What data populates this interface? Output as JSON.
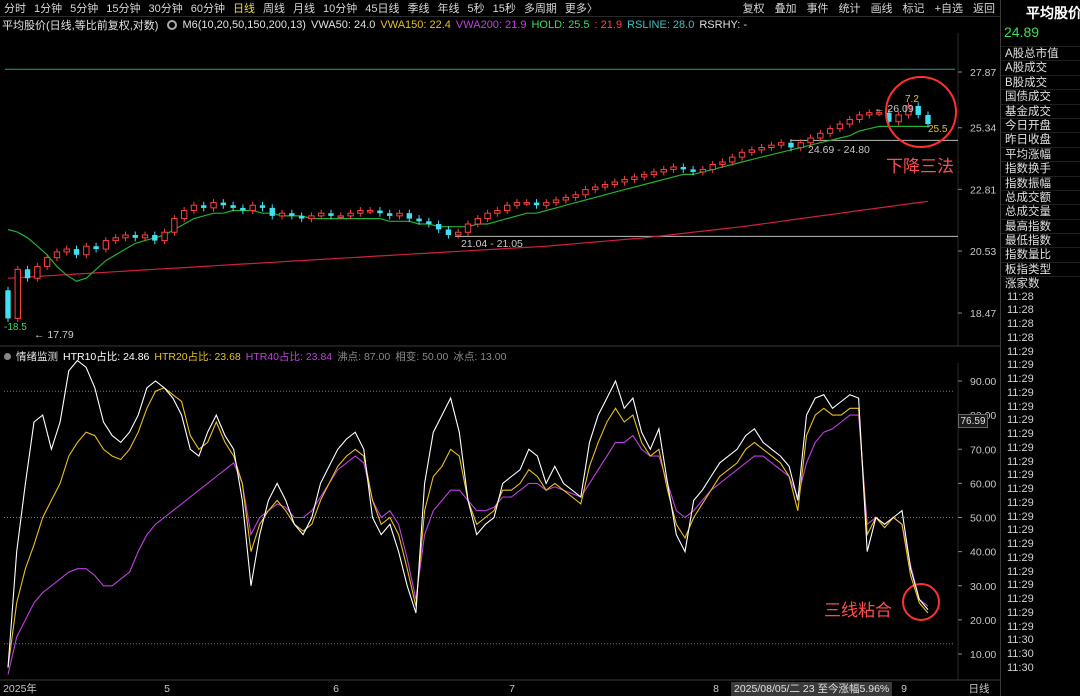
{
  "toolbar": {
    "periods": [
      {
        "label": "分时"
      },
      {
        "label": "1分钟"
      },
      {
        "label": "5分钟"
      },
      {
        "label": "15分钟"
      },
      {
        "label": "30分钟"
      },
      {
        "label": "60分钟"
      },
      {
        "label": "日线",
        "active": true
      },
      {
        "label": "周线"
      },
      {
        "label": "月线"
      },
      {
        "label": "10分钟"
      },
      {
        "label": "45日线"
      },
      {
        "label": "季线"
      },
      {
        "label": "年线"
      },
      {
        "label": "5秒"
      },
      {
        "label": "15秒"
      },
      {
        "label": "多周期"
      },
      {
        "label": "更多〉"
      }
    ],
    "right_buttons": [
      "复权",
      "叠加",
      "事件",
      "统计",
      "画线",
      "标记",
      "+自选",
      "返回"
    ]
  },
  "infobar": {
    "title": "平均股价(日线,等比前复权,对数)",
    "ma_label": "M6(10,20,50,150,200,13)",
    "vwa50": "VWA50: 24.0",
    "vwa150": "VWA150: 22.4",
    "vwa200": "VWA200: 21.9",
    "hold": "HOLD: 25.5",
    "hold_extra": ": 21.9",
    "rsline": "RSLINE: 28.0",
    "rsrhy": "RSRHY: -"
  },
  "indicator": {
    "name": "情绪监测",
    "htr10": "HTR10占比: 24.86",
    "htr20": "HTR20占比: 23.68",
    "htr40": "HTR40占比: 23.84",
    "boil": "沸点: 87.00",
    "phase": "相变: 50.00",
    "ice": "冰点: 13.00"
  },
  "price_axis": [
    "27.87",
    "25.34",
    "22.81",
    "20.53",
    "18.47"
  ],
  "ind_axis": [
    "90.00",
    "80.00",
    "70.00",
    "60.00",
    "50.00",
    "40.00",
    "30.00",
    "20.00",
    "10.00"
  ],
  "x_axis": [
    "2025年",
    "5",
    "6",
    "7",
    "8",
    "9",
    "日线"
  ],
  "price_labels": {
    "low": "17.79",
    "low_left": "-18.5",
    "range1": "21.04 - 21.05",
    "range2": "24.69 - 24.80",
    "high": "26.09",
    "top_val": "7.2",
    "last": "25.5"
  },
  "indicator_tag": "76.59",
  "date_tag": "2025/08/05/二 23 至今涨幅5.96%",
  "annotations": {
    "a1": "下降三法",
    "a2": "三线粘合"
  },
  "sidebar": {
    "title": "平均股价",
    "value": "24.89",
    "items": [
      "A股总市值",
      "A股成交",
      "B股成交",
      "国债成交",
      "基金成交",
      "今日开盘",
      "昨日收盘",
      "平均涨幅",
      "指数换手",
      "指数振幅",
      "总成交额",
      "总成交量",
      "最高指数",
      "最低指数",
      "指数量比",
      "板指类型",
      "涨家数"
    ],
    "times": [
      "11:28",
      "11:28",
      "11:28",
      "11:28",
      "11:29",
      "11:29",
      "11:29",
      "11:29",
      "11:29",
      "11:29",
      "11:29",
      "11:29",
      "11:29",
      "11:29",
      "11:29",
      "11:29",
      "11:29",
      "11:29",
      "11:29",
      "11:29",
      "11:29",
      "11:29",
      "11:29",
      "11:29",
      "11:29",
      "11:30",
      "11:30",
      "11:30"
    ]
  },
  "chart_data": {
    "type": "candlestick",
    "price_series": {
      "closes": [
        18.3,
        19.9,
        19.6,
        20.0,
        20.3,
        20.5,
        20.6,
        20.4,
        20.7,
        20.6,
        20.9,
        21.0,
        21.1,
        21.0,
        21.1,
        20.9,
        21.2,
        21.7,
        22.0,
        22.2,
        22.1,
        22.3,
        22.2,
        22.1,
        22.0,
        22.2,
        22.1,
        21.8,
        21.9,
        21.8,
        21.7,
        21.8,
        21.9,
        21.8,
        21.8,
        21.9,
        22.0,
        22.0,
        21.9,
        21.8,
        21.9,
        21.7,
        21.6,
        21.5,
        21.3,
        21.1,
        21.2,
        21.5,
        21.7,
        21.9,
        22.0,
        22.2,
        22.3,
        22.3,
        22.2,
        22.3,
        22.4,
        22.5,
        22.6,
        22.8,
        22.9,
        23.0,
        23.1,
        23.2,
        23.3,
        23.4,
        23.5,
        23.6,
        23.7,
        23.6,
        23.5,
        23.6,
        23.8,
        23.9,
        24.1,
        24.3,
        24.4,
        24.5,
        24.6,
        24.7,
        24.5,
        24.7,
        24.9,
        25.1,
        25.3,
        25.5,
        25.7,
        25.9,
        26.0,
        26.0,
        25.6,
        25.9,
        26.3,
        25.9,
        25.5
      ],
      "vwa_green": [
        21.3,
        21.2,
        21.0,
        20.7,
        20.4,
        20.0,
        19.7,
        19.5,
        19.6,
        19.9,
        20.2,
        20.4,
        20.6,
        20.8,
        20.9,
        21.0,
        21.1,
        21.3,
        21.5,
        21.7,
        21.8,
        21.9,
        21.9,
        22.0,
        22.0,
        22.0,
        21.9,
        21.9,
        21.8,
        21.8,
        21.8,
        21.7,
        21.7,
        21.7,
        21.7,
        21.7,
        21.7,
        21.7,
        21.7,
        21.6,
        21.6,
        21.6,
        21.5,
        21.5,
        21.4,
        21.4,
        21.4,
        21.4,
        21.5,
        21.5,
        21.6,
        21.7,
        21.8,
        21.9,
        21.9,
        22.0,
        22.1,
        22.2,
        22.3,
        22.4,
        22.5,
        22.6,
        22.7,
        22.8,
        22.9,
        23.0,
        23.1,
        23.2,
        23.3,
        23.4,
        23.4,
        23.5,
        23.6,
        23.7,
        23.8,
        23.9,
        24.0,
        24.1,
        24.2,
        24.3,
        24.4,
        24.5,
        24.6,
        24.7,
        24.8,
        24.9,
        25.0,
        25.2,
        25.3,
        25.4,
        25.4,
        25.4,
        25.4,
        25.4,
        25.4
      ],
      "vwa_red": [
        19.6,
        19.62,
        19.64,
        19.66,
        19.68,
        19.7,
        19.72,
        19.74,
        19.76,
        19.78,
        19.8,
        19.82,
        19.84,
        19.86,
        19.88,
        19.9,
        19.92,
        19.94,
        19.96,
        19.98,
        20.0,
        20.02,
        20.04,
        20.06,
        20.08,
        20.1,
        20.12,
        20.14,
        20.16,
        20.18,
        20.2,
        20.22,
        20.24,
        20.26,
        20.28,
        20.3,
        20.32,
        20.34,
        20.36,
        20.38,
        20.4,
        20.42,
        20.44,
        20.46,
        20.48,
        20.5,
        20.52,
        20.54,
        20.56,
        20.58,
        20.6,
        20.62,
        20.64,
        20.66,
        20.68,
        20.7,
        20.73,
        20.76,
        20.79,
        20.82,
        20.85,
        20.88,
        20.91,
        20.94,
        20.97,
        21.0,
        21.04,
        21.08,
        21.12,
        21.16,
        21.2,
        21.24,
        21.28,
        21.32,
        21.36,
        21.4,
        21.45,
        21.5,
        21.55,
        21.6,
        21.65,
        21.7,
        21.75,
        21.8,
        21.85,
        21.9,
        21.95,
        22.0,
        22.05,
        22.1,
        22.15,
        22.2,
        22.25,
        22.3,
        22.35
      ],
      "support_lines": [
        21.05,
        24.8
      ],
      "resistance_line": 28.0
    },
    "indicator_series": [
      {
        "name": "HTR10占比",
        "color": "#ffffff",
        "values": [
          6,
          40,
          60,
          78,
          80,
          70,
          78,
          93,
          96,
          94,
          88,
          78,
          74,
          72,
          75,
          80,
          88,
          90,
          88,
          85,
          80,
          70,
          68,
          75,
          80,
          74,
          70,
          55,
          30,
          45,
          55,
          60,
          55,
          48,
          45,
          50,
          60,
          65,
          70,
          73,
          75,
          70,
          50,
          45,
          48,
          40,
          30,
          22,
          60,
          75,
          80,
          85,
          75,
          55,
          45,
          48,
          50,
          60,
          62,
          64,
          70,
          68,
          60,
          65,
          60,
          58,
          56,
          72,
          80,
          85,
          90,
          82,
          85,
          75,
          70,
          76,
          60,
          45,
          40,
          55,
          58,
          62,
          66,
          68,
          70,
          74,
          76,
          72,
          70,
          68,
          65,
          55,
          80,
          85,
          86,
          82,
          84,
          86,
          85,
          40,
          50,
          48,
          50,
          52,
          35,
          26,
          23
        ]
      },
      {
        "name": "HTR20占比",
        "color": "#e8c020",
        "values": [
          6,
          25,
          35,
          42,
          50,
          55,
          60,
          68,
          72,
          75,
          74,
          70,
          68,
          67,
          70,
          75,
          82,
          87,
          88,
          86,
          84,
          74,
          70,
          72,
          78,
          72,
          68,
          60,
          40,
          48,
          52,
          55,
          52,
          48,
          46,
          48,
          55,
          60,
          65,
          68,
          70,
          68,
          55,
          48,
          50,
          45,
          35,
          24,
          52,
          62,
          65,
          70,
          68,
          55,
          48,
          50,
          52,
          58,
          58,
          60,
          64,
          62,
          58,
          60,
          58,
          56,
          54,
          65,
          72,
          78,
          82,
          78,
          80,
          72,
          68,
          70,
          58,
          48,
          44,
          50,
          54,
          58,
          62,
          64,
          66,
          70,
          72,
          70,
          68,
          66,
          62,
          52,
          74,
          80,
          82,
          80,
          80,
          82,
          82,
          45,
          50,
          47,
          50,
          48,
          33,
          25,
          22
        ]
      },
      {
        "name": "HTR40占比",
        "color": "#c040e0",
        "values": [
          4,
          15,
          20,
          25,
          28,
          30,
          32,
          34,
          35,
          35,
          33,
          30,
          30,
          32,
          34,
          40,
          45,
          48,
          50,
          52,
          54,
          56,
          58,
          60,
          62,
          64,
          66,
          60,
          45,
          50,
          52,
          54,
          53,
          50,
          50,
          52,
          56,
          60,
          64,
          66,
          68,
          66,
          55,
          50,
          52,
          48,
          38,
          26,
          45,
          52,
          55,
          58,
          58,
          55,
          52,
          52,
          53,
          56,
          56,
          58,
          60,
          60,
          58,
          59,
          58,
          57,
          56,
          60,
          64,
          68,
          72,
          72,
          74,
          70,
          68,
          68,
          60,
          52,
          50,
          52,
          55,
          58,
          60,
          62,
          64,
          66,
          68,
          68,
          66,
          64,
          62,
          56,
          66,
          72,
          75,
          76,
          78,
          80,
          80,
          48,
          50,
          48,
          50,
          48,
          36,
          26,
          24
        ]
      }
    ],
    "indicator_levels": {
      "boil": 87,
      "phase": 50,
      "ice": 13
    },
    "x_ticks": [
      "2025年",
      "5",
      "6",
      "7",
      "8",
      "9"
    ]
  }
}
